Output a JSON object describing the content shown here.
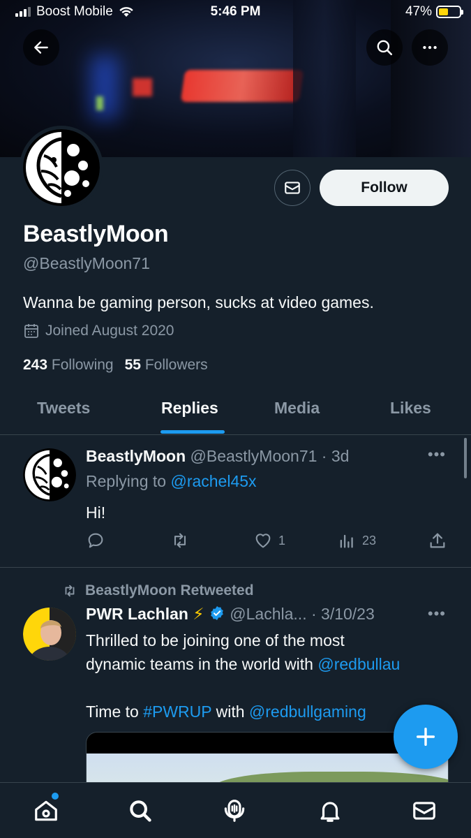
{
  "status_bar": {
    "carrier": "Boost Mobile",
    "time": "5:46 PM",
    "battery": "47%",
    "battery_level": 0.47,
    "battery_color": "#ffd60a"
  },
  "header": {
    "back_icon": "arrow-left-icon",
    "search_icon": "search-icon",
    "more_icon": "more-horizontal-icon"
  },
  "profile": {
    "display_name": "BeastlyMoon",
    "handle": "@BeastlyMoon71",
    "bio": "Wanna be gaming person, sucks at video games.",
    "joined": "Joined August 2020",
    "following_count": "243",
    "following_label": "Following",
    "followers_count": "55",
    "followers_label": "Followers",
    "follow_label": "Follow",
    "message_icon": "envelope-icon"
  },
  "tabs": [
    {
      "label": "Tweets",
      "active": false
    },
    {
      "label": "Replies",
      "active": true
    },
    {
      "label": "Media",
      "active": false
    },
    {
      "label": "Likes",
      "active": false
    }
  ],
  "tweets": [
    {
      "name": "BeastlyMoon",
      "handle_time": "@BeastlyMoon71 · 3d",
      "replying_prefix": "Replying to ",
      "replying_to": "@rachel45x",
      "text": "Hi!",
      "likes": "1",
      "views": "23"
    },
    {
      "retweeted_by": "BeastlyMoon Retweeted",
      "name": "PWR Lachlan",
      "emoji": "⚡",
      "handle_time": "@Lachla... · 3/10/23",
      "line1": "Thrilled to be joining one of the most",
      "line2_prefix": "dynamic teams in the world with ",
      "line2_link": "@redbullau",
      "line3_prefix": "Time to ",
      "line3_hashtag": "#PWRUP",
      "line3_mid": " with ",
      "line3_link": "@redbullgaming"
    }
  ],
  "colors": {
    "background": "#15202b",
    "accent": "#1d9bf0",
    "muted": "#8b98a5"
  },
  "bottom_nav": [
    "home-icon",
    "search-icon",
    "spaces-icon",
    "notifications-icon",
    "messages-icon"
  ]
}
